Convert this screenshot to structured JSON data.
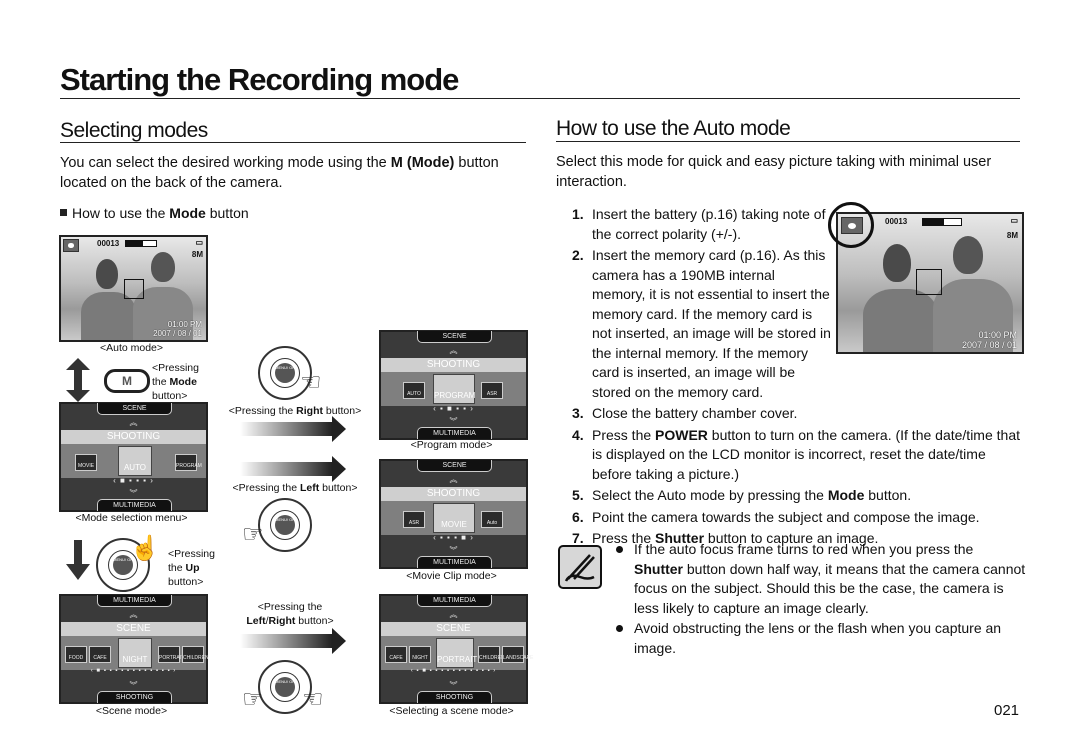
{
  "page": {
    "title": "Starting the Recording mode",
    "page_number": "021"
  },
  "left": {
    "heading": "Selecting modes",
    "intro_before": "You can select the desired working mode using the ",
    "intro_bold": "M (Mode)",
    "intro_after": " button located on the back of the camera.",
    "subheading_before": "How to use the ",
    "subheading_bold": "Mode",
    "subheading_after": " button",
    "figures": {
      "auto_mode_caption": "<Auto mode>",
      "mode_button_label": "M",
      "press_mode_before": "<Pressing the ",
      "press_mode_bold": "Mode",
      "press_mode_after": " button>",
      "mode_menu_caption": "<Mode selection menu>",
      "press_up_before": "<Pressing the ",
      "press_up_bold": "Up",
      "press_up_after": " button>",
      "scene_mode_caption": "<Scene mode>",
      "press_right_before": "<Pressing the ",
      "press_right_bold": "Right",
      "press_right_after": " button>",
      "press_left_before": "<Pressing the ",
      "press_left_bold": "Left",
      "press_left_after": " button>",
      "press_lr_before": "<Pressing the",
      "press_lr_bold1": "Left",
      "press_lr_sep": "/",
      "press_lr_bold2": "Right",
      "press_lr_after": " button>",
      "program_mode_caption": "<Program mode>",
      "movie_mode_caption": "<Movie Clip mode>",
      "select_scene_caption": "<Selecting a scene mode>",
      "dial_center": "MENU/ OK"
    }
  },
  "lcd": {
    "shot_count": "00013",
    "time": "01:00 PM",
    "date": "2007 / 08 / 01",
    "size": "8M"
  },
  "menus": {
    "mode_selection": {
      "top": "SCENE",
      "band": "SHOOTING",
      "bottom": "MULTIMEDIA",
      "left": "MOVIE",
      "selected": "AUTO",
      "right": "PROGRAM",
      "dots": "■ ▪ ▪ ▪"
    },
    "program": {
      "top": "SCENE",
      "band": "SHOOTING",
      "bottom": "MULTIMEDIA",
      "left": "AUTO",
      "selected": "PROGRAM",
      "right": "ASR",
      "dots": "▪ ■ ▪ ▪"
    },
    "movie": {
      "top": "SCENE",
      "band": "SHOOTING",
      "bottom": "MULTIMEDIA",
      "left": "ASR",
      "selected": "MOVIE",
      "right": "Auto",
      "dots": "▪ ▪ ▪ ■"
    },
    "scene": {
      "top": "MULTIMEDIA",
      "band": "SCENE",
      "bottom": "SHOOTING",
      "left2": "FOOD",
      "left": "CAFE",
      "selected": "NIGHT",
      "right": "PORTRAIT",
      "right2": "CHILDREN",
      "dots": "■ ▪ ▪ ▪ ▪ ▪ ▪ ▪ ▪ ▪ ▪ ▪ ▪"
    },
    "scene_select": {
      "top": "MULTIMEDIA",
      "band": "SCENE",
      "bottom": "SHOOTING",
      "left2": "CAFE",
      "left": "NIGHT",
      "selected": "PORTRAIT",
      "right": "CHILDREN",
      "right2": "LANDSCAPE",
      "dots": "▪ ■ ▪ ▪ ▪ ▪ ▪ ▪ ▪ ▪ ▪ ▪ ▪"
    }
  },
  "right": {
    "heading": "How to use the Auto mode",
    "intro": "Select this mode for quick and easy picture taking with minimal user interaction.",
    "steps": [
      {
        "num": "1.",
        "text": "Insert the battery (p.16) taking note of the correct polarity (+/-)."
      },
      {
        "num": "2.",
        "text": "Insert the memory card (p.16). As this camera has a 190MB internal memory, it is not essential to insert the memory card. If the memory card is not inserted, an image will be stored in the internal memory. If the memory card is inserted, an image will be stored on the memory card."
      },
      {
        "num": "3.",
        "text": "Close the battery chamber cover."
      },
      {
        "num": "4.",
        "before": "Press the ",
        "bold": "POWER",
        "after": " button to turn on the camera. (If the date/time that is displayed on the LCD monitor is incorrect, reset the date/time before taking a picture.)"
      },
      {
        "num": "5.",
        "before": "Select the Auto mode by pressing the ",
        "bold": "Mode",
        "after": " button."
      },
      {
        "num": "6.",
        "text": "Point the camera towards the subject and compose the image."
      },
      {
        "num": "7.",
        "before": "Press the ",
        "bold": "Shutter",
        "after": " button to capture an image."
      }
    ],
    "notes": [
      {
        "before": "If the auto focus frame turns to red when you press the ",
        "bold": "Shutter",
        "after": " button down half way, it means that the camera cannot focus on the subject. Should this be the case, the camera is less likely to capture an image clearly."
      },
      {
        "text": "Avoid obstructing the lens or the flash when you capture an image."
      }
    ]
  }
}
